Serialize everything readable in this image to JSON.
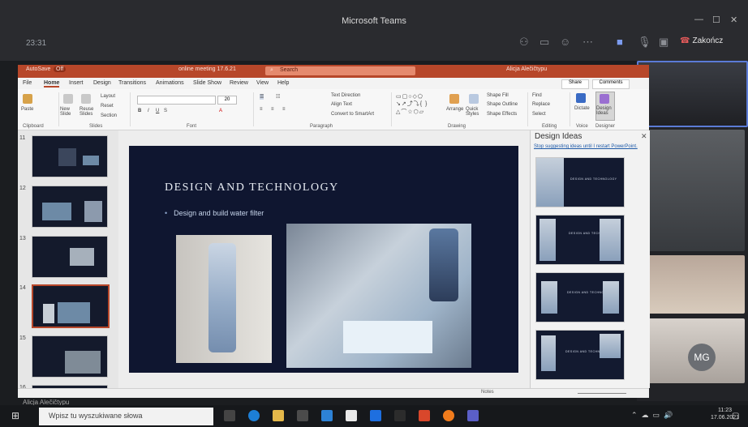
{
  "teams": {
    "window_title": "Microsoft Teams",
    "meeting_timer": "23:31",
    "leave_label": "Zakończ",
    "participant_initials": "MG",
    "presenter_name": "Alicja Alečičtypu"
  },
  "ppt": {
    "autosave_label": "AutoSave",
    "autosave_state": "Off",
    "file_name": "online meeting 17.6.21",
    "search_placeholder": "Search",
    "user_name": "Alicja Alečičtypu",
    "tabs": [
      "File",
      "Home",
      "Insert",
      "Design",
      "Transitions",
      "Animations",
      "Slide Show",
      "Review",
      "View",
      "Help"
    ],
    "share_label": "Share",
    "comments_label": "Comments",
    "ribbon": {
      "paste": "Paste",
      "new_slide": "New Slide",
      "reuse_slides": "Reuse Slides",
      "layout": "Layout",
      "reset": "Reset",
      "section": "Section",
      "font_size": "20",
      "text_direction": "Text Direction",
      "align_text": "Align Text",
      "convert_smartart": "Convert to SmartArt",
      "arrange": "Arrange",
      "quick_styles": "Quick Styles",
      "shape_fill": "Shape Fill",
      "shape_outline": "Shape Outline",
      "shape_effects": "Shape Effects",
      "find": "Find",
      "replace": "Replace",
      "select": "Select",
      "dictate": "Dictate",
      "design_ideas": "Design Ideas",
      "groups": [
        "Clipboard",
        "Slides",
        "Font",
        "Paragraph",
        "Drawing",
        "Editing",
        "Voice",
        "Designer"
      ]
    },
    "thumbnails": [
      {
        "number": "11"
      },
      {
        "number": "12"
      },
      {
        "number": "13"
      },
      {
        "number": "14",
        "selected": true
      },
      {
        "number": "15"
      },
      {
        "number": "16"
      }
    ],
    "slide": {
      "title": "DESIGN AND TECHNOLOGY",
      "bullet": "Design and build water filter"
    },
    "design_ideas": {
      "title": "Design Ideas",
      "stop_link": "Stop suggesting ideas until I restart PowerPoint.",
      "card_text": "DESIGN AND TECHNOLOGY"
    },
    "status": {
      "notes": "Notes"
    }
  },
  "taskbar": {
    "search_placeholder": "Wpisz tu wyszukiwane słowa",
    "time": "11:23",
    "date": "17.06.2021"
  }
}
